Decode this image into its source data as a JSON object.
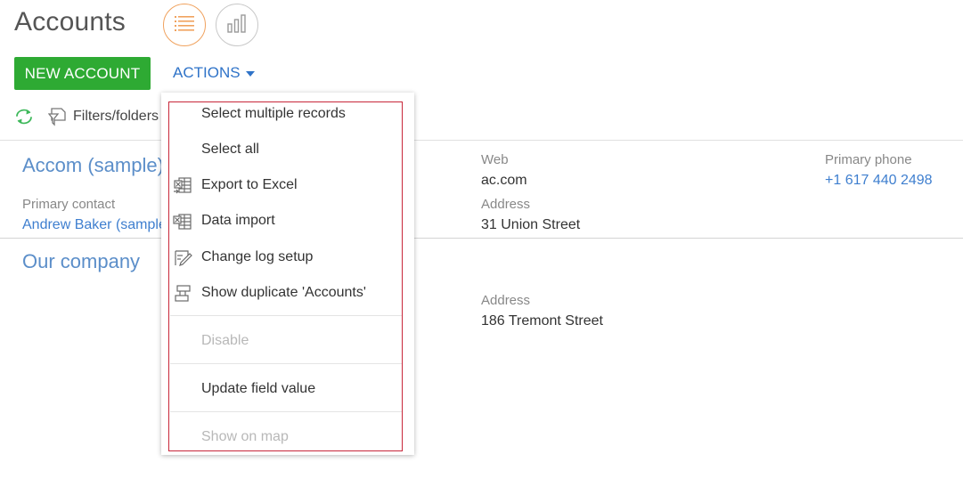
{
  "header": {
    "title": "Accounts",
    "list_view_icon": "list-icon",
    "analytics_view_icon": "bar-chart-icon",
    "accent_color": "#f0a25e"
  },
  "toolbar": {
    "new_account_label": "NEW ACCOUNT",
    "new_account_color": "#2eaa33",
    "actions_label": "ACTIONS",
    "refresh_icon": "refresh-icon",
    "filter_icon": "filter-folder-icon",
    "filters_label": "Filters/folders"
  },
  "records": [
    {
      "name": "Accom (sample)",
      "primary_contact_caption": "Primary contact",
      "primary_contact": "Andrew Baker (sample)",
      "web_caption": "Web",
      "web": "ac.com",
      "address_caption": "Address",
      "address": "31 Union Street",
      "phone_caption": "Primary phone",
      "phone": "+1 617 440 2498"
    },
    {
      "name": "Our company",
      "address_caption": "Address",
      "address": "186 Tremont Street"
    }
  ],
  "actions_menu": {
    "items": [
      {
        "label": "Select multiple records",
        "icon": "",
        "disabled": false
      },
      {
        "label": "Select all",
        "icon": "",
        "disabled": false
      },
      {
        "label": "Export to Excel",
        "icon": "excel-export-icon",
        "disabled": false
      },
      {
        "label": "Data import",
        "icon": "excel-import-icon",
        "disabled": false
      },
      {
        "label": "Change log setup",
        "icon": "edit-log-icon",
        "disabled": false
      },
      {
        "label": "Show duplicate 'Accounts'",
        "icon": "duplicates-icon",
        "disabled": false
      },
      {
        "label": "Disable",
        "icon": "",
        "disabled": true
      },
      {
        "label": "Update field value",
        "icon": "",
        "disabled": false
      },
      {
        "label": "Show on map",
        "icon": "",
        "disabled": true
      }
    ],
    "highlight_color": "#c8273a"
  }
}
